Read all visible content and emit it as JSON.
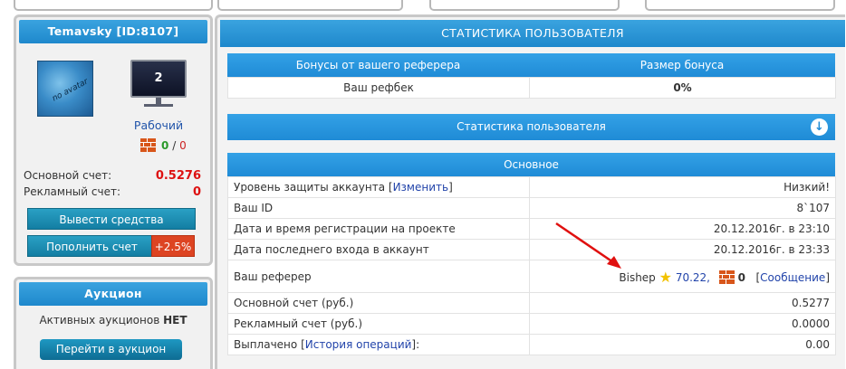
{
  "user": {
    "name_label": "Temavsky [ID:8107]",
    "avatar_text": "no avatar",
    "monitor_number": "2",
    "status": "Рабочий",
    "bricks_a": "0",
    "bricks_sep": "/",
    "bricks_b": "0",
    "main_account_label": "Основной счет:",
    "main_account_value": "0.5276",
    "ad_account_label": "Рекламный счет:",
    "ad_account_value": "0",
    "withdraw_button": "Вывести средства",
    "topup_button": "Пополнить счет",
    "topup_badge": "+2.5%"
  },
  "auction": {
    "title": "Аукцион",
    "active_prefix": "Активных аукционов",
    "active_value": "НЕТ",
    "go_button": "Перейти в аукцион"
  },
  "main": {
    "title": "СТАТИСТИКА ПОЛЬЗОВАТЕЛЯ",
    "bonus": {
      "col1": "Бонусы от вашего реферера",
      "col2": "Размер бонуса",
      "row_label": "Ваш рефбек",
      "row_value": "0%"
    },
    "stats_bar": "Статистика пользователя",
    "section_title": "Основное",
    "rows": {
      "security_label": "Уровень защиты аккаунта",
      "security_link": "Изменить",
      "security_value": "Низкий!",
      "id_label": "Ваш ID",
      "id_value": "8`107",
      "reg_label": "Дата и время регистрации на проекте",
      "reg_value": "20.12.2016г. в 23:10",
      "last_label": "Дата последнего входа в аккаунт",
      "last_value": "20.12.2016г. в 23:33",
      "ref_label": "Ваш реферер",
      "ref_name": "Bishep",
      "ref_rating": "70.22,",
      "ref_bricks": "0",
      "ref_message": "Сообщение",
      "main_acc_label": "Основной счет (руб.)",
      "main_acc_value": "0.5277",
      "ad_acc_label": "Рекламный счет (руб.)",
      "ad_acc_value": "0.0000",
      "paid_label": "Выплачено",
      "paid_link": "История операций",
      "paid_value": "0.00"
    }
  },
  "colors": {
    "accent_blue": "#1f8bd6",
    "danger_red": "#dd1111",
    "topup_orange": "#dd4422"
  }
}
